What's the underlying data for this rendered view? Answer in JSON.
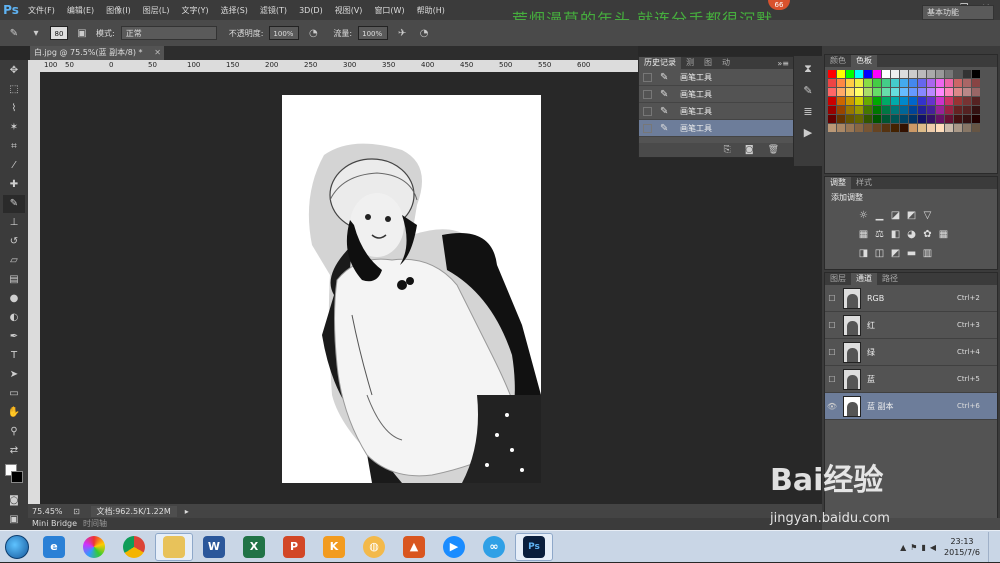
{
  "app": {
    "logo": "Ps"
  },
  "menu": [
    "文件(F)",
    "编辑(E)",
    "图像(I)",
    "图层(L)",
    "文字(Y)",
    "选择(S)",
    "滤镜(T)",
    "3D(D)",
    "视图(V)",
    "窗口(W)",
    "帮助(H)"
  ],
  "watermark_title": "荒烟漫草的年头 就连分手都很沉默",
  "badge_count": "66",
  "options": {
    "brush_size": "80",
    "mode_label": "模式:",
    "mode_value": "正常",
    "opacity_label": "不透明度:",
    "opacity_value": "100%",
    "flow_label": "流量:",
    "flow_value": "100%",
    "workspace": "基本功能"
  },
  "document": {
    "tab_title": "白.jpg @ 75.5%(蓝 副本/8) *",
    "zoom": "75.45%",
    "doc_info": "文档:962.5K/1.22M"
  },
  "ruler": [
    "100",
    "50",
    "0",
    "50",
    "100",
    "150",
    "200",
    "250",
    "300",
    "350",
    "400",
    "450",
    "500",
    "550",
    "600"
  ],
  "bottom_tabs": [
    "Mini Bridge",
    "时间轴"
  ],
  "history": {
    "tabs": [
      "历史记录",
      "测",
      "图",
      "动"
    ],
    "items": [
      {
        "label": "画笔工具"
      },
      {
        "label": "画笔工具"
      },
      {
        "label": "画笔工具"
      },
      {
        "label": "画笔工具"
      }
    ]
  },
  "swatches": {
    "tabs": [
      "颜色",
      "色板"
    ]
  },
  "adjustments": {
    "tabs": [
      "调整",
      "样式"
    ],
    "title": "添加调整"
  },
  "channels": {
    "tabs": [
      "图层",
      "通道",
      "路径"
    ],
    "items": [
      {
        "name": "RGB",
        "shortcut": "Ctrl+2",
        "visible": false
      },
      {
        "name": "红",
        "shortcut": "Ctrl+3",
        "visible": false
      },
      {
        "name": "绿",
        "shortcut": "Ctrl+4",
        "visible": false
      },
      {
        "name": "蓝",
        "shortcut": "Ctrl+5",
        "visible": false
      },
      {
        "name": "蓝 副本",
        "shortcut": "Ctrl+6",
        "visible": true
      }
    ]
  },
  "taskbar": {
    "clock_time": "23:13",
    "clock_date": "2015/7/6"
  },
  "baidu_watermark": {
    "brand": "Bai经验",
    "url": "jingyan.baidu.com"
  }
}
